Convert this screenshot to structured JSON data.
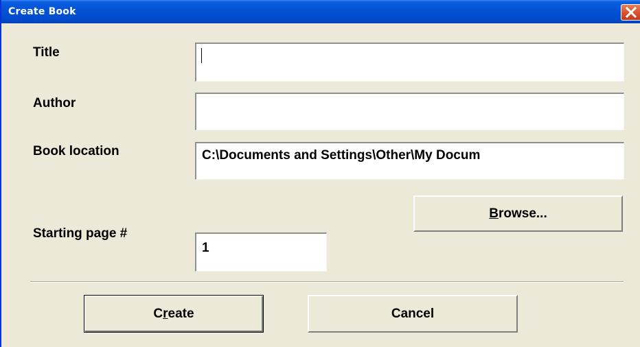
{
  "window": {
    "title": "Create Book"
  },
  "form": {
    "title_label": "Title",
    "title_value": "",
    "author_label": "Author",
    "author_value": "",
    "location_label": "Book location",
    "location_value": "C:\\Documents and Settings\\Other\\My Docum",
    "start_page_label": "Starting page #",
    "start_page_value": "1"
  },
  "buttons": {
    "browse": {
      "mnemonic": "B",
      "rest": "rowse..."
    },
    "create": {
      "pre": "C",
      "mnemonic": "r",
      "rest": "eate"
    },
    "cancel": "Cancel"
  },
  "icons": {
    "close": "close-icon"
  },
  "colors": {
    "titlebar": "#0353d6",
    "dialog_bg": "#ece9d8",
    "close_button": "#d8512f"
  }
}
